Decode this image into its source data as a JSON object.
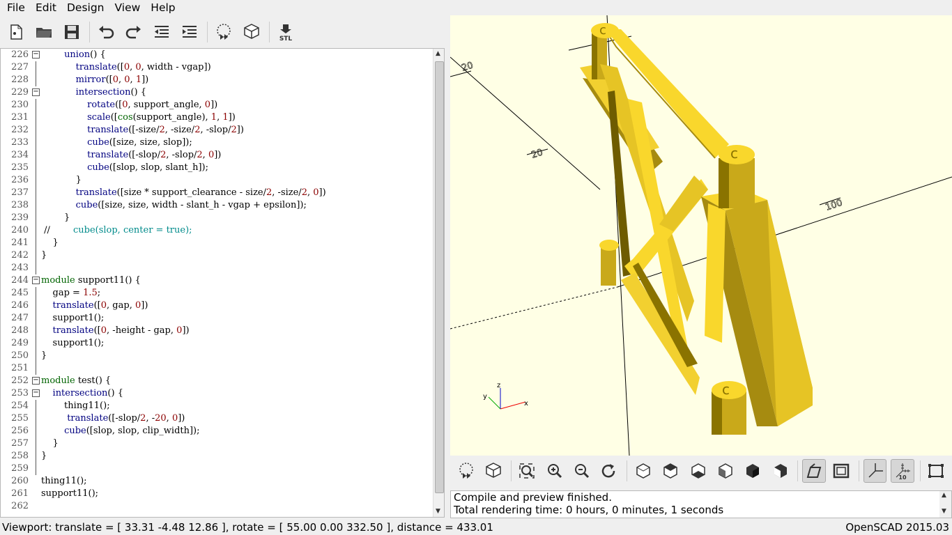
{
  "menu": [
    "File",
    "Edit",
    "Design",
    "View",
    "Help"
  ],
  "toolbar": [
    {
      "name": "new-file-icon"
    },
    {
      "name": "open-file-icon"
    },
    {
      "name": "save-file-icon"
    },
    {
      "name": "undo-icon"
    },
    {
      "name": "redo-icon"
    },
    {
      "name": "unindent-icon"
    },
    {
      "name": "indent-icon"
    },
    {
      "name": "preview-icon"
    },
    {
      "name": "render-icon"
    },
    {
      "name": "export-stl-icon",
      "label": "STL"
    }
  ],
  "editor": {
    "lines": [
      {
        "n": "226",
        "code": "        union() {"
      },
      {
        "n": "227",
        "code": "            translate([0, 0, width - vgap])"
      },
      {
        "n": "228",
        "code": "            mirror([0, 0, 1])"
      },
      {
        "n": "229",
        "code": "            intersection() {"
      },
      {
        "n": "230",
        "code": "                rotate([0, support_angle, 0])"
      },
      {
        "n": "231",
        "code": "                scale([cos(support_angle), 1, 1])"
      },
      {
        "n": "232",
        "code": "                translate([-size/2, -size/2, -slop/2])"
      },
      {
        "n": "233",
        "code": "                cube([size, size, slop]);"
      },
      {
        "n": "234",
        "code": "                translate([-slop/2, -slop/2, 0])"
      },
      {
        "n": "235",
        "code": "                cube([slop, slop, slant_h]);"
      },
      {
        "n": "236",
        "code": "            }"
      },
      {
        "n": "237",
        "code": "            translate([size * support_clearance - size/2, -size/2, 0])"
      },
      {
        "n": "238",
        "code": "            cube([size, size, width - slant_h - vgap + epsilon]);"
      },
      {
        "n": "239",
        "code": "        }"
      },
      {
        "n": "240",
        "code": " //        cube(slop, center = true);"
      },
      {
        "n": "241",
        "code": "    }"
      },
      {
        "n": "242",
        "code": "}"
      },
      {
        "n": "243",
        "code": ""
      },
      {
        "n": "244",
        "code": "module support11() {"
      },
      {
        "n": "245",
        "code": "    gap = 1.5;"
      },
      {
        "n": "246",
        "code": "    translate([0, gap, 0])"
      },
      {
        "n": "247",
        "code": "    support1();"
      },
      {
        "n": "248",
        "code": "    translate([0, -height - gap, 0])"
      },
      {
        "n": "249",
        "code": "    support1();"
      },
      {
        "n": "250",
        "code": "}"
      },
      {
        "n": "251",
        "code": ""
      },
      {
        "n": "252",
        "code": "module test() {"
      },
      {
        "n": "253",
        "code": "    intersection() {"
      },
      {
        "n": "254",
        "code": "        thing11();"
      },
      {
        "n": "255",
        "code": "         translate([-slop/2, -20, 0])"
      },
      {
        "n": "256",
        "code": "        cube([slop, slop, clip_width]);"
      },
      {
        "n": "257",
        "code": "    }"
      },
      {
        "n": "258",
        "code": "}"
      },
      {
        "n": "259",
        "code": ""
      },
      {
        "n": "260",
        "code": "thing11();"
      },
      {
        "n": "261",
        "code": "support11();"
      },
      {
        "n": "262",
        "code": ""
      }
    ]
  },
  "viewport_tools": [
    {
      "name": "preview-icon"
    },
    {
      "name": "render-icon"
    },
    {
      "name": "view-all-icon"
    },
    {
      "name": "zoom-in-icon"
    },
    {
      "name": "zoom-out-icon"
    },
    {
      "name": "reset-view-icon"
    },
    {
      "name": "view-right-icon"
    },
    {
      "name": "view-top-icon"
    },
    {
      "name": "view-bottom-icon"
    },
    {
      "name": "view-left-icon"
    },
    {
      "name": "view-front-icon"
    },
    {
      "name": "view-back-icon"
    },
    {
      "name": "perspective-icon",
      "active": true
    },
    {
      "name": "orthogonal-icon"
    },
    {
      "name": "show-axes-icon",
      "active": true
    },
    {
      "name": "show-scale-markers-icon",
      "active": true,
      "label": "10"
    },
    {
      "name": "show-edges-icon"
    }
  ],
  "axis_scale_labels": [
    "20",
    "20",
    "100"
  ],
  "axes_gizmo": {
    "x": "x",
    "y": "y",
    "z": "z"
  },
  "console": {
    "line1": "Compile and preview finished.",
    "line2": "Total rendering time: 0 hours, 0 minutes, 1 seconds"
  },
  "status": {
    "viewport": "Viewport: translate = [ 33.31 -4.48 12.86 ], rotate = [ 55.00 0.00 332.50 ], distance = 433.01",
    "version": "OpenSCAD 2015.03"
  },
  "colors": {
    "model": "#f9d72c",
    "model_shadow": "#8a7300",
    "viewport_bg": "#ffffe5"
  }
}
